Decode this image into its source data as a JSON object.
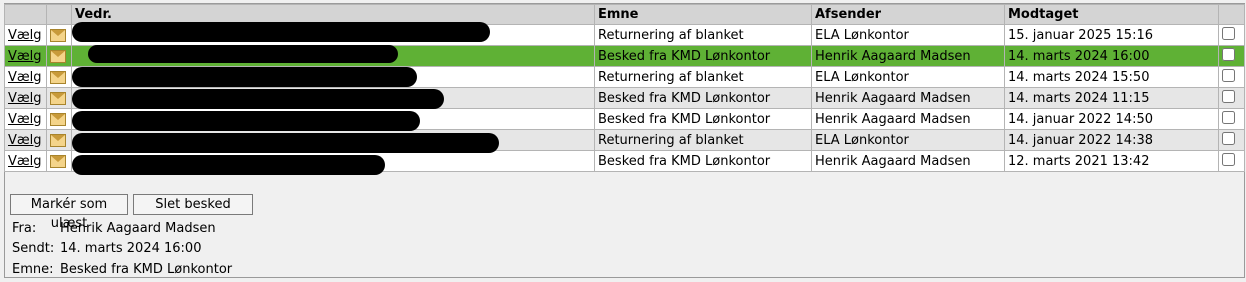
{
  "columns": {
    "vaelg": "",
    "icon": "",
    "vedr": "Vedr.",
    "emne": "Emne",
    "afsender": "Afsender",
    "modtaget": "Modtaget",
    "check": ""
  },
  "rows": [
    {
      "link": "Vælg",
      "emne": "Returnering af blanket",
      "afsender": "ELA Lønkontor",
      "modtaget": "15. januar 2025 15:16",
      "selected": false
    },
    {
      "link": "Vælg",
      "emne": "Besked fra KMD Lønkontor",
      "afsender": "Henrik Aagaard Madsen",
      "modtaget": "14. marts 2024 16:00",
      "selected": true
    },
    {
      "link": "Vælg",
      "emne": "Returnering af blanket",
      "afsender": "ELA Lønkontor",
      "modtaget": "14. marts 2024 15:50",
      "selected": false
    },
    {
      "link": "Vælg",
      "emne": "Besked fra KMD Lønkontor",
      "afsender": "Henrik Aagaard Madsen",
      "modtaget": "14. marts 2024 11:15",
      "selected": false
    },
    {
      "link": "Vælg",
      "emne": "Besked fra KMD Lønkontor",
      "afsender": "Henrik Aagaard Madsen",
      "modtaget": "14. januar 2022 14:50",
      "selected": false
    },
    {
      "link": "Vælg",
      "emne": "Returnering af blanket",
      "afsender": "ELA Lønkontor",
      "modtaget": "14. januar 2022 14:38",
      "selected": false
    },
    {
      "link": "Vælg",
      "emne": "Besked fra KMD Lønkontor",
      "afsender": "Henrik Aagaard Madsen",
      "modtaget": "12. marts 2021 13:42",
      "selected": false
    }
  ],
  "buttons": {
    "mark_unread": "Markér som ulæst",
    "delete": "Slet besked"
  },
  "detail": {
    "fra_label": "Fra:",
    "fra_value": "Henrik Aagaard Madsen",
    "sendt_label": "Sendt:",
    "sendt_value": "14. marts 2024 16:00",
    "emne_label": "Emne:",
    "emne_value": "Besked fra KMD Lønkontor"
  },
  "colors": {
    "selected_row": "#5fb135",
    "header_bg": "#d4d4d4",
    "alt_row": "#e6e6e6"
  },
  "icons": {
    "message": "envelope-icon"
  }
}
